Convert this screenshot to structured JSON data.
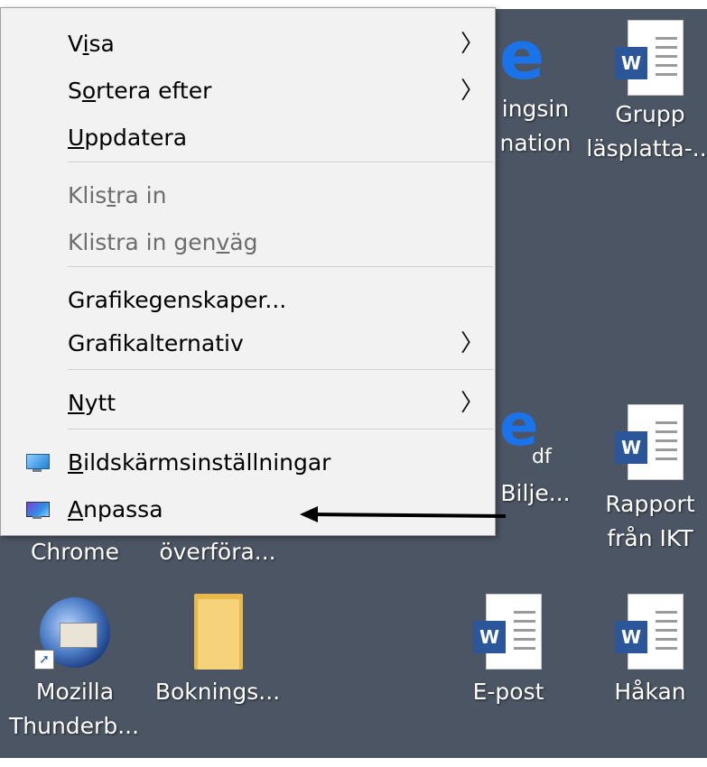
{
  "context_menu": {
    "items": [
      {
        "pre": "V",
        "acc": "i",
        "post": "sa",
        "submenu": true
      },
      {
        "pre": "S",
        "acc": "o",
        "post": "rtera efter",
        "submenu": true
      },
      {
        "pre": "",
        "acc": "U",
        "post": "ppdatera",
        "submenu": false
      },
      {
        "pre": "Klis",
        "acc": "t",
        "post": "ra in",
        "submenu": false,
        "disabled": true
      },
      {
        "pre": "Klistra in gen",
        "acc": "v",
        "post": "äg",
        "submenu": false,
        "disabled": true
      },
      {
        "pre": "Grafikegenskaper...",
        "acc": "",
        "post": "",
        "submenu": false
      },
      {
        "pre": "Grafikalternativ",
        "acc": "",
        "post": "",
        "submenu": true
      },
      {
        "pre": "",
        "acc": "N",
        "post": "ytt",
        "submenu": true
      },
      {
        "pre": "",
        "acc": "B",
        "post": "ildskärmsinställningar",
        "submenu": false,
        "icon": "display-settings-icon"
      },
      {
        "pre": "",
        "acc": "A",
        "post": "npassa",
        "submenu": false,
        "icon": "personalize-icon"
      }
    ],
    "submenu_glyph": "〉"
  },
  "desktop_icons": {
    "bokningsinfo": {
      "line1": "ingsin",
      "line2": "nation",
      "icon": "edge-icon"
    },
    "grupp": {
      "line1": "Grupp",
      "line2": "läsplatta-...",
      "icon": "word-doc-icon"
    },
    "biljett": {
      "badge": "df",
      "label": "Bilje...",
      "icon": "edge-pdf-icon"
    },
    "rapport": {
      "line1": "Rapport",
      "line2": "från IKT",
      "icon": "word-doc-icon"
    },
    "chrome": {
      "label": "Chrome"
    },
    "overfora": {
      "label": "överföra..."
    },
    "thunderbird": {
      "line1": "Mozilla",
      "line2": "Thunderb...",
      "icon": "thunderbird-icon"
    },
    "boknings": {
      "label": "Boknings...",
      "icon": "folder-icon"
    },
    "epost": {
      "label": "E-post",
      "icon": "word-doc-icon"
    },
    "hakan": {
      "label": "Håkan",
      "icon": "word-doc-icon"
    }
  },
  "word_badge": "W",
  "edge_letter": "e",
  "shortcut_arrow": "➚",
  "colors": {
    "desktop": "#4b5563",
    "menu_bg": "#f2f2f2",
    "word_blue": "#2b579a",
    "edge_blue": "#1a73e8"
  }
}
